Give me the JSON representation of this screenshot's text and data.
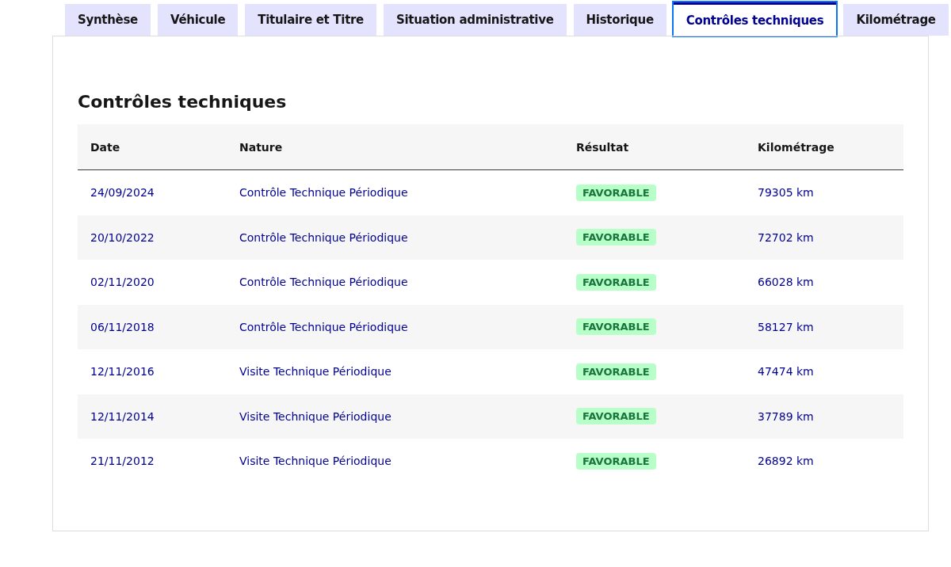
{
  "tabs": [
    {
      "label": "Synthèse",
      "selected": false
    },
    {
      "label": "Véhicule",
      "selected": false
    },
    {
      "label": "Titulaire et Titre",
      "selected": false
    },
    {
      "label": "Situation administrative",
      "selected": false
    },
    {
      "label": "Historique",
      "selected": false
    },
    {
      "label": "Contrôles techniques",
      "selected": true
    },
    {
      "label": "Kilométrage",
      "selected": false
    }
  ],
  "section": {
    "title": "Contrôles techniques"
  },
  "table": {
    "columns": [
      "Date",
      "Nature",
      "Résultat",
      "Kilométrage"
    ],
    "rows": [
      {
        "date": "24/09/2024",
        "nature": "Contrôle Technique Périodique",
        "result": "FAVORABLE",
        "mileage": "79305 km"
      },
      {
        "date": "20/10/2022",
        "nature": "Contrôle Technique Périodique",
        "result": "FAVORABLE",
        "mileage": "72702 km"
      },
      {
        "date": "02/11/2020",
        "nature": "Contrôle Technique Périodique",
        "result": "FAVORABLE",
        "mileage": "66028 km"
      },
      {
        "date": "06/11/2018",
        "nature": "Contrôle Technique Périodique",
        "result": "FAVORABLE",
        "mileage": "58127 km"
      },
      {
        "date": "12/11/2016",
        "nature": "Visite Technique Périodique",
        "result": "FAVORABLE",
        "mileage": "47474 km"
      },
      {
        "date": "12/11/2014",
        "nature": "Visite Technique Périodique",
        "result": "FAVORABLE",
        "mileage": "37789 km"
      },
      {
        "date": "21/11/2012",
        "nature": "Visite Technique Périodique",
        "result": "FAVORABLE",
        "mileage": "26892 km"
      }
    ]
  }
}
